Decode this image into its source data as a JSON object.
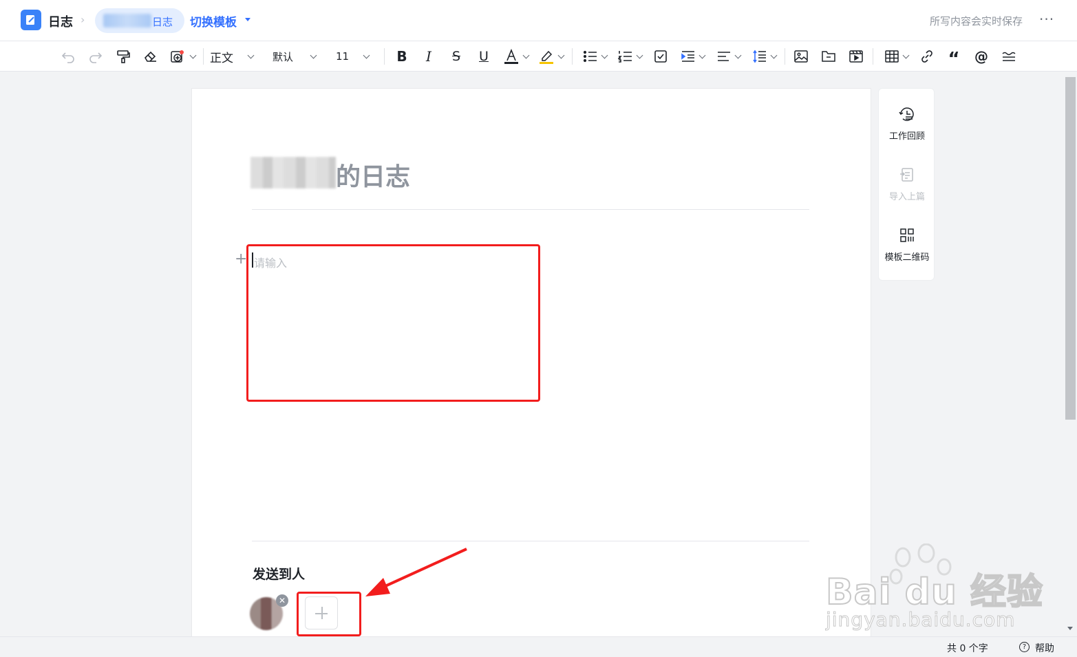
{
  "header": {
    "app_title": "日志",
    "breadcrumb_label": "日志",
    "switch_template": "切换模板",
    "save_status": "所写内容会实时保存",
    "more": "···"
  },
  "toolbar": {
    "paragraph_style": "正文",
    "font_family": "默认",
    "font_size": "11",
    "icons": [
      "undo-icon",
      "redo-icon",
      "format-painter-icon",
      "eraser-icon",
      "insert-block-icon",
      "bold-icon",
      "italic-icon",
      "strikethrough-icon",
      "underline-icon",
      "font-color-icon",
      "highlight-icon",
      "bullet-list-icon",
      "numbered-list-icon",
      "checklist-icon",
      "indent-icon",
      "align-icon",
      "line-spacing-icon",
      "image-icon",
      "file-icon",
      "video-icon",
      "table-icon",
      "link-icon",
      "quote-icon",
      "mention-icon",
      "divider-icon"
    ],
    "accent_colors": {
      "font_color": "#1f2329",
      "highlight": "#f5c400"
    }
  },
  "document": {
    "title_suffix": "的日志",
    "placeholder": "请输入",
    "send_to_label": "发送到人"
  },
  "side_panel": {
    "items": [
      {
        "label": "工作回顾",
        "icon": "history-icon",
        "enabled": true
      },
      {
        "label": "导入上篇",
        "icon": "import-icon",
        "enabled": false
      },
      {
        "label": "模板二维码",
        "icon": "qrcode-icon",
        "enabled": true
      }
    ]
  },
  "footer": {
    "word_count": "共 0 个字",
    "help": "帮助"
  },
  "watermark": {
    "logo": "Bai du 经验",
    "url": "jingyan.baidu.com"
  },
  "colors": {
    "accent": "#3370ff",
    "annotation": "#f21d1d"
  }
}
